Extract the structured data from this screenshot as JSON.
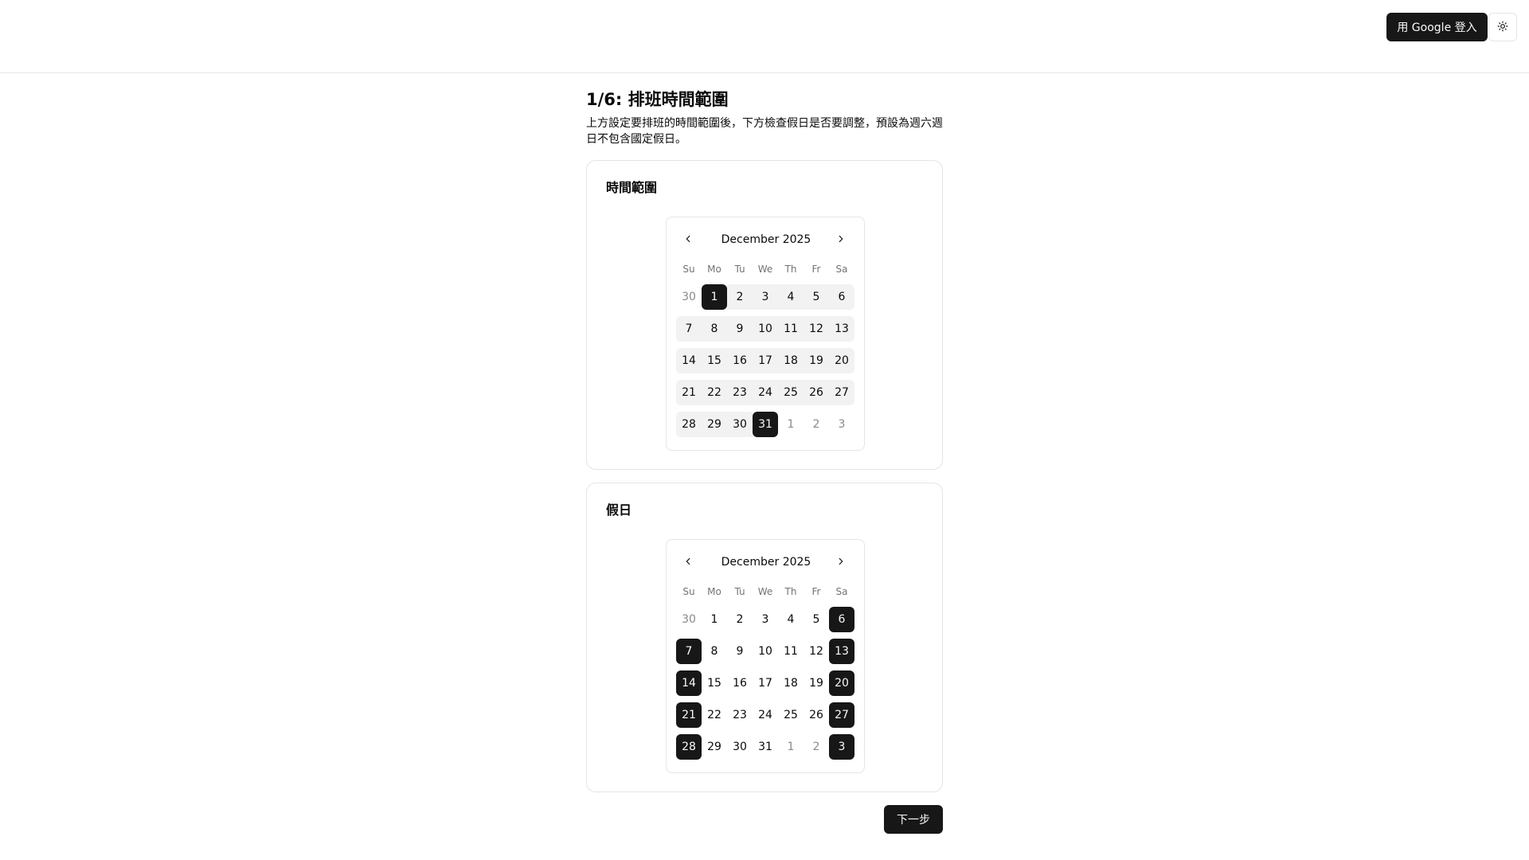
{
  "header": {
    "login_label": "用 Google 登入",
    "theme_icon": "sun-icon"
  },
  "page": {
    "title": "1/6: 排班時間範圍",
    "description": "上方設定要排班的時間範圍後，下方檢查假日是否要調整，預設為週六週日不包含國定假日。"
  },
  "range_card": {
    "title": "時間範圍",
    "calendar": {
      "month_label": "December 2025",
      "weekdays": [
        "Su",
        "Mo",
        "Tu",
        "We",
        "Th",
        "Fr",
        "Sa"
      ],
      "range_start": "2025-12-01",
      "range_end": "2025-12-31",
      "weeks": [
        [
          "30",
          "1",
          "2",
          "3",
          "4",
          "5",
          "6"
        ],
        [
          "7",
          "8",
          "9",
          "10",
          "11",
          "12",
          "13"
        ],
        [
          "14",
          "15",
          "16",
          "17",
          "18",
          "19",
          "20"
        ],
        [
          "21",
          "22",
          "23",
          "24",
          "25",
          "26",
          "27"
        ],
        [
          "28",
          "29",
          "30",
          "31",
          "1",
          "2",
          "3"
        ]
      ]
    }
  },
  "holiday_card": {
    "title": "假日",
    "calendar": {
      "month_label": "December 2025",
      "weekdays": [
        "Su",
        "Mo",
        "Tu",
        "We",
        "Th",
        "Fr",
        "Sa"
      ],
      "selected_dates": [
        "2025-12-06",
        "2025-12-07",
        "2025-12-13",
        "2025-12-14",
        "2025-12-20",
        "2025-12-21",
        "2025-12-27",
        "2025-12-28",
        "2026-01-03"
      ],
      "weeks": [
        [
          "30",
          "1",
          "2",
          "3",
          "4",
          "5",
          "6"
        ],
        [
          "7",
          "8",
          "9",
          "10",
          "11",
          "12",
          "13"
        ],
        [
          "14",
          "15",
          "16",
          "17",
          "18",
          "19",
          "20"
        ],
        [
          "21",
          "22",
          "23",
          "24",
          "25",
          "26",
          "27"
        ],
        [
          "28",
          "29",
          "30",
          "31",
          "1",
          "2",
          "3"
        ]
      ]
    }
  },
  "footer": {
    "next_label": "下一步"
  }
}
